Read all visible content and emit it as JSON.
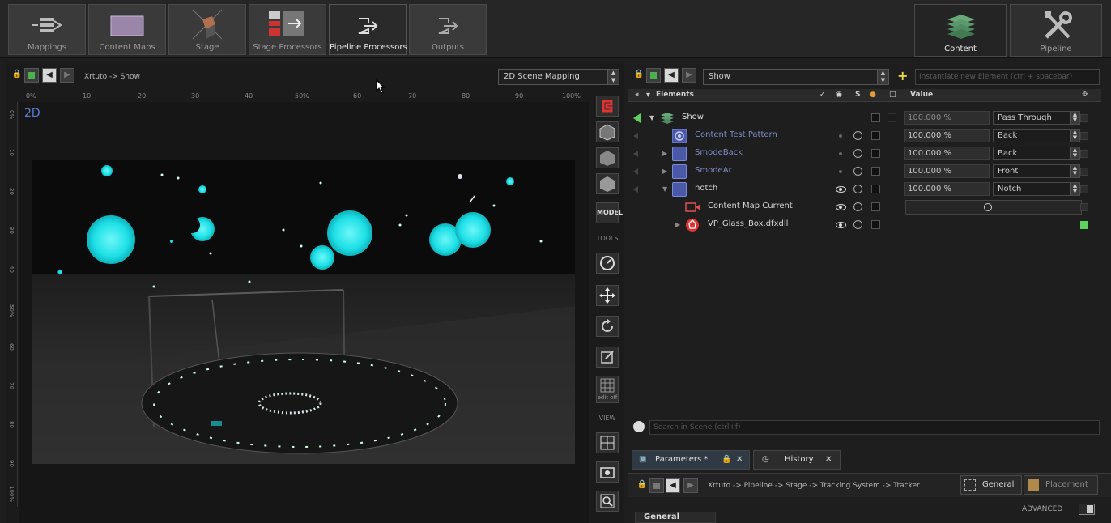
{
  "top_tabs": [
    {
      "label": "Mappings",
      "icon": "mappings-icon"
    },
    {
      "label": "Content Maps",
      "icon": "content-maps-icon"
    },
    {
      "label": "Stage",
      "icon": "stage-icon"
    },
    {
      "label": "Stage Processors",
      "icon": "stage-processors-icon"
    },
    {
      "label": "Pipeline Processors",
      "icon": "pipeline-processors-icon",
      "active": true
    },
    {
      "label": "Outputs",
      "icon": "outputs-icon"
    }
  ],
  "right_tabs": [
    {
      "label": "Content",
      "icon": "content-layers-icon",
      "active": true
    },
    {
      "label": "Pipeline",
      "icon": "pipeline-tools-icon"
    }
  ],
  "viewport": {
    "breadcrumb": "Xrtuto -> Show",
    "mapping_select": "2D Scene Mapping",
    "mode_label": "2D",
    "ruler_top": [
      "0%",
      "10",
      "20",
      "30",
      "40",
      "50%",
      "60",
      "70",
      "80",
      "90",
      "100%"
    ],
    "ruler_left": [
      "0%",
      "10",
      "20",
      "30",
      "40",
      "50%",
      "60",
      "70",
      "80",
      "90",
      "100%"
    ]
  },
  "tools": {
    "model_label": "MODEL",
    "tools_label": "TOOLS",
    "edit_off_label": "edit off",
    "view_label": "VIEW"
  },
  "content": {
    "show_select": "Show",
    "new_element_placeholder": "Instantiate new Element (ctrl + spacebar)",
    "headers": {
      "elements": "Elements",
      "solo": "S",
      "value": "Value"
    },
    "rows": [
      {
        "name": "Show",
        "value": "100.000 %",
        "blend": "Pass Through",
        "level": 0
      },
      {
        "name": "Content Test Pattern",
        "value": "100.000 %",
        "blend": "Back",
        "level": 1
      },
      {
        "name": "SmodeBack",
        "value": "100.000 %",
        "blend": "Back",
        "level": 1
      },
      {
        "name": "SmodeAr",
        "value": "100.000 %",
        "blend": "Front",
        "level": 1
      },
      {
        "name": "notch",
        "value": "100.000 %",
        "blend": "Notch",
        "level": 1
      },
      {
        "name": "Content Map Current",
        "value": "",
        "blend": "",
        "level": 2
      },
      {
        "name": "VP_Glass_Box.dfxdll",
        "value": "",
        "blend": "",
        "level": 1
      }
    ],
    "search_placeholder": "Search in Scene (ctrl+f)"
  },
  "params": {
    "tab_parameters": "Parameters *",
    "tab_history": "History",
    "breadcrumb": "Xrtuto -> Pipeline -> Stage -> Tracking System -> Tracker",
    "subtab_general": "General",
    "subtab_placement": "Placement",
    "advanced_label": "ADVANCED",
    "section_general": "General"
  },
  "colors": {
    "accent_blue": "#5a7fd6",
    "cyan": "#1de0e6",
    "node_purple": "#4a58a8",
    "green": "#5fd35f"
  }
}
